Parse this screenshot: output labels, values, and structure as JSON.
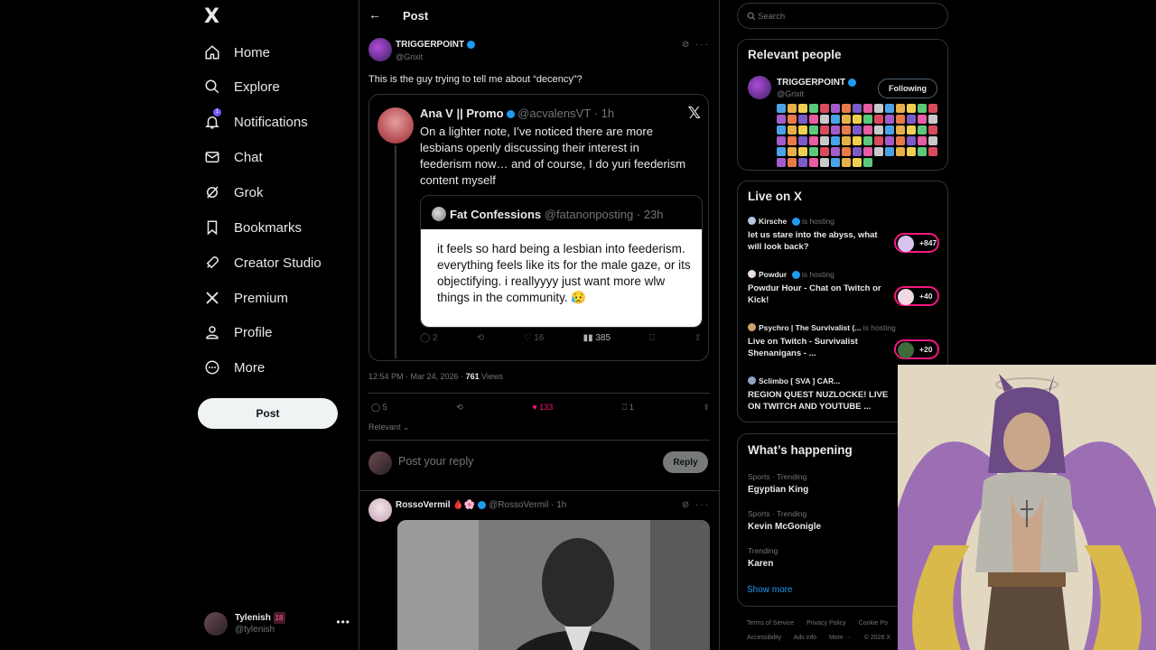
{
  "nav": {
    "logo": "X",
    "items": [
      {
        "label": "Home",
        "icon": "home-icon"
      },
      {
        "label": "Explore",
        "icon": "search-icon"
      },
      {
        "label": "Notifications",
        "icon": "bell-icon",
        "badge": "1"
      },
      {
        "label": "Chat",
        "icon": "mail-icon"
      },
      {
        "label": "Grok",
        "icon": "grok-icon"
      },
      {
        "label": "Bookmarks",
        "icon": "bookmark-icon"
      },
      {
        "label": "Creator Studio",
        "icon": "rocket-icon"
      },
      {
        "label": "Premium",
        "icon": "x-icon"
      },
      {
        "label": "Profile",
        "icon": "person-icon"
      },
      {
        "label": "More",
        "icon": "more-circle-icon"
      }
    ],
    "post_label": "Post",
    "me": {
      "name": "Tylenish",
      "tag": "18",
      "handle": "@tylenish"
    }
  },
  "header": {
    "title": "Post"
  },
  "tweet": {
    "name": "TRIGGERPOINT",
    "handle": "@Grixit",
    "text": "This is the guy trying to tell me about “decency”?",
    "quote": {
      "name": "Ana V || Promo",
      "handle": "@acvalensVT",
      "time": "· 1h",
      "text": "On a lighter note, I’ve noticed there are more lesbians openly discussing their interest in feederism now… and of course, I do yuri feederism content myself",
      "inner": {
        "name": "Fat Confessions",
        "handle": "@fatanonposting",
        "time": "· 23h",
        "card_text": "it feels so hard being a lesbian into feederism. everything feels like its for the male gaze, or its objectifying. i reallyyyy just want more wlw things in the community. 😥"
      },
      "actions": {
        "replies": "2",
        "reposts": "",
        "likes": "16",
        "views": "385"
      }
    },
    "timestamp": "12:54 PM · Mar 24, 2026 ·",
    "views": "761",
    "views_label": "Views",
    "actions": {
      "replies": "5",
      "reposts": "",
      "likes": "133",
      "bookmarks": "1"
    },
    "sort_label": "Relevant"
  },
  "reply": {
    "placeholder": "Post your reply",
    "button": "Reply"
  },
  "tweet2": {
    "name": "RossoVermil",
    "handle": "@RossoVermil",
    "time": "· 1h"
  },
  "right": {
    "search_placeholder": "Search",
    "relevant": {
      "title": "Relevant people",
      "name": "TRIGGERPOINT",
      "handle": "@Grixit",
      "follow_label": "Following"
    },
    "live": {
      "title": "Live on X",
      "items": [
        {
          "host": "Kirsche",
          "status": "is hosting",
          "title": "let us stare into the abyss, what will look back?",
          "count": "+847"
        },
        {
          "host": "Powdur",
          "status": "is hosting",
          "title": "Powdur Hour - Chat on Twitch or  Kick!",
          "count": "+40"
        },
        {
          "host": "Psychro | The Survivalist (...",
          "status": "is hosting",
          "title": "Live on Twitch - Survivalist Shenanigans - ...",
          "count": "+20"
        },
        {
          "host": "Sclimbo [ SVA ] CAR...",
          "status": "",
          "title": "REGION QUEST NUZLOCKE! LIVE ON TWITCH AND YOUTUBE ...",
          "count": ""
        }
      ]
    },
    "happening": {
      "title": "What’s happening",
      "trends": [
        {
          "category": "Sports · Trending",
          "name": "Egyptian King"
        },
        {
          "category": "Sports · Trending",
          "name": "Kevin McGonigle"
        },
        {
          "category": "Trending",
          "name": "Karen"
        }
      ],
      "show_more": "Show more"
    },
    "footer": {
      "line1": [
        "Terms of Service",
        "Privacy Policy",
        "Cookie Po"
      ],
      "line2": [
        "Accessibility",
        "Ads info",
        "More ···",
        "© 2026 X"
      ]
    }
  },
  "colors": {
    "accent": "#1d9bf0",
    "like": "#f91880",
    "background": "#000000",
    "border": "#2f3336"
  }
}
